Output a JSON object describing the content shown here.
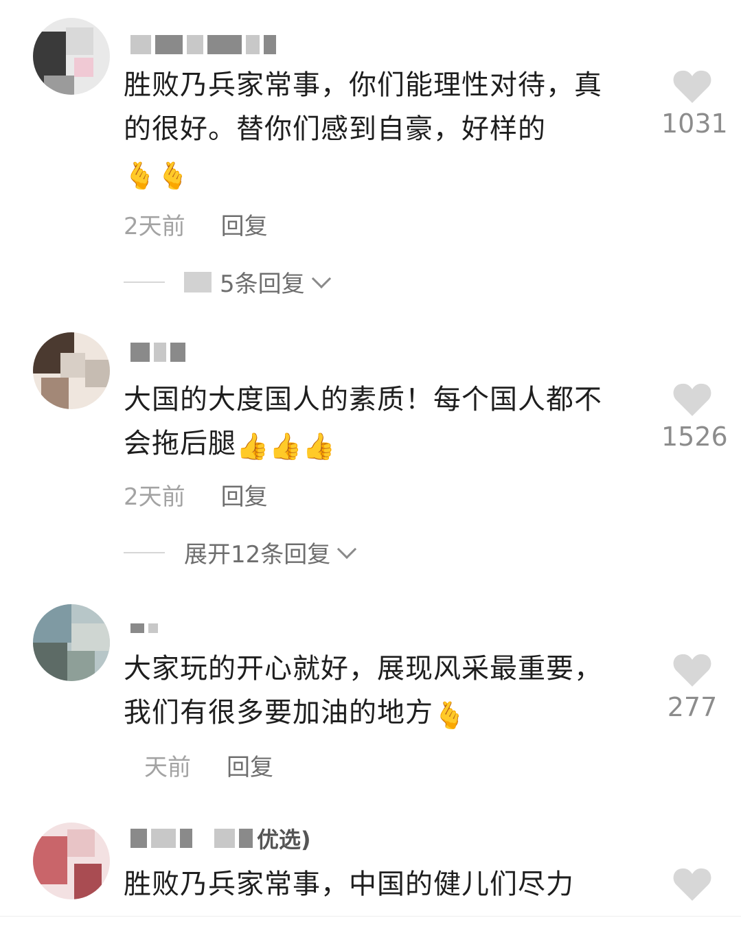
{
  "comments": [
    {
      "text": "胜败乃兵家常事，你们能理性对待，真的很好。替你们感到自豪，好样的",
      "emoji": "🫰🫰",
      "time": "2天前",
      "reply_label": "回复",
      "expand_label": "5条回复",
      "likes": "1031",
      "avatar_colors": [
        "#3a3a3a",
        "#d9d9d9",
        "#f0c9d4",
        "#9b9b9b"
      ]
    },
    {
      "text": "大国的大度国人的素质！每个国人都不会拖后腿",
      "emoji": "👍👍👍",
      "time": "2天前",
      "reply_label": "回复",
      "expand_label": "展开12条回复",
      "likes": "1526",
      "avatar_colors": [
        "#4b3a30",
        "#d8cfc6",
        "#a38877",
        "#efe6de"
      ]
    },
    {
      "text": "大家玩的开心就好，展现风采最重要，我们有很多要加油的地方",
      "emoji": "🫰",
      "time": "天前",
      "reply_label": "回复",
      "likes": "277",
      "avatar_colors": [
        "#7f9aa3",
        "#b7c6c8",
        "#5d6b66",
        "#cfd6d2"
      ]
    },
    {
      "username_tail": "优选)",
      "text": "胜败乃兵家常事，中国的健儿们尽力",
      "avatar_colors": [
        "#c9656a",
        "#e8c4c6",
        "#f3e1e2",
        "#a94c52"
      ]
    }
  ],
  "icons": {
    "like": "heart-icon",
    "expand": "chevron-down-icon"
  },
  "colors": {
    "heart": "#d7d7d7",
    "meta": "#a3a3a3",
    "reply": "#6e6e6e",
    "text": "#1e1e1e"
  }
}
